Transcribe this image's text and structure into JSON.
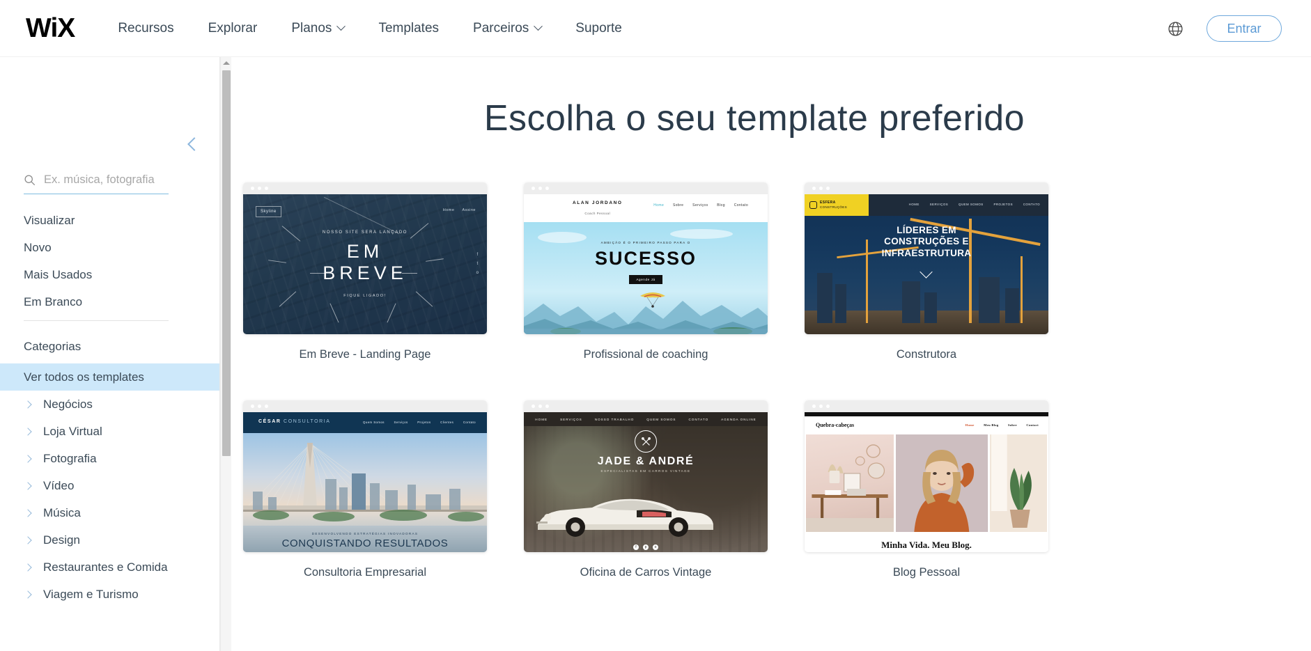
{
  "header": {
    "logo": "WiX",
    "nav": [
      {
        "label": "Recursos",
        "has_caret": false
      },
      {
        "label": "Explorar",
        "has_caret": false
      },
      {
        "label": "Planos",
        "has_caret": true
      },
      {
        "label": "Templates",
        "has_caret": false
      },
      {
        "label": "Parceiros",
        "has_caret": true
      },
      {
        "label": "Suporte",
        "has_caret": false
      }
    ],
    "language_icon": "globe-icon",
    "login_label": "Entrar"
  },
  "sidebar": {
    "collapse_icon": "chevron-left-icon",
    "search": {
      "icon": "search-icon",
      "placeholder": "Ex. música, fotografia",
      "value": ""
    },
    "links": [
      "Visualizar",
      "Novo",
      "Mais Usados",
      "Em Branco"
    ],
    "categories_heading": "Categorias",
    "all_templates": "Ver todos os templates",
    "categories": [
      "Negócios",
      "Loja Virtual",
      "Fotografia",
      "Vídeo",
      "Música",
      "Design",
      "Restaurantes e Comida",
      "Viagem e Turismo"
    ],
    "scrollbar": {
      "up_arrow_icon": "triangle-up-icon"
    },
    "highlight_color": "#cde8fa",
    "accent_color": "#5b9ad5"
  },
  "main": {
    "title": "Escolha o seu template preferido",
    "templates": [
      {
        "title": "Em Breve - Landing Page",
        "preview": {
          "logo": "Skyline",
          "nav": [
            "Home",
            "Assine"
          ],
          "eyebrow": "NOSSO SITE SERÁ LANÇADO",
          "headline_1": "EM",
          "headline_2": "BREVE",
          "tagline": "FIQUE LIGADO!",
          "social": [
            "f",
            "t",
            "o"
          ]
        }
      },
      {
        "title": "Profissional de coaching",
        "preview": {
          "brand": "ALAN JORDANO",
          "brand_sub": "Coach Pessoal",
          "nav": [
            "Home",
            "Sobre",
            "Serviços",
            "Blog",
            "Contato"
          ],
          "eyebrow": "AMBIÇÃO É O PRIMEIRO PASSO PARA O",
          "headline": "SUCESSO",
          "button": "Agende Já"
        }
      },
      {
        "title": "Construtora",
        "preview": {
          "logo_line1": "ESFERA",
          "logo_line2": "CONSTRUÇÕES",
          "nav": [
            "HOME",
            "SERVIÇOS",
            "QUEM SOMOS",
            "PROJETOS",
            "CONTATO"
          ],
          "headline_1": "LÍDERES EM",
          "headline_2": "CONSTRUÇÕES E",
          "headline_3": "INFRAESTRUTURA",
          "scroll_icon": "chevron-down-icon"
        }
      },
      {
        "title": "Consultoria Empresarial",
        "preview": {
          "brand": "CÉSAR",
          "brand_light": " CONSULTORIA",
          "nav": [
            "Quem Somos",
            "Serviços",
            "Projetos",
            "Clientes",
            "Contato"
          ],
          "eyebrow": "DESENVOLVENDO ESTRATÉGIAS INOVADORAS",
          "headline": "CONQUISTANDO RESULTADOS"
        }
      },
      {
        "title": "Oficina de Carros Vintage",
        "preview": {
          "nav": [
            "HOME",
            "SERVIÇOS",
            "NOSSO TRABALHO",
            "QUEM SOMOS",
            "CONTATO",
            "AGENDA ONLINE"
          ],
          "logo_icon": "crossed-wrenches-icon",
          "title": "JADE & ANDRÉ",
          "subtitle": "ESPECIALISTAS EM CARROS VINTAGE",
          "social": [
            "f",
            "p",
            "o"
          ]
        }
      },
      {
        "title": "Blog Pessoal",
        "preview": {
          "brand": "Quebra-cabeças",
          "nav": [
            "Home",
            "Meu Blog",
            "Sobre",
            "Contact"
          ],
          "quote": "Minha Vida. Meu Blog."
        }
      }
    ]
  }
}
